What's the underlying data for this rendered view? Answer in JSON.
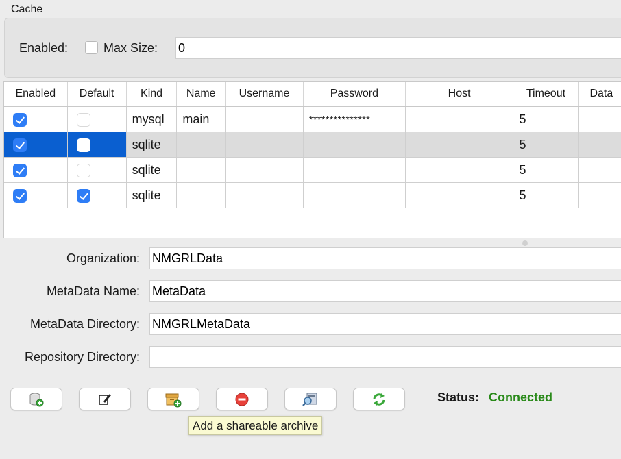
{
  "cache": {
    "group_label": "Cache",
    "enabled_label": "Enabled:",
    "enabled": false,
    "max_size_label": "Max Size:",
    "max_size_value": "0"
  },
  "table": {
    "columns": [
      "Enabled",
      "Default",
      "Kind",
      "Name",
      "Username",
      "Password",
      "Host",
      "Timeout",
      "Data"
    ],
    "rows": [
      {
        "enabled": true,
        "default": false,
        "kind": "mysql",
        "name": "main",
        "username": "",
        "password": "***************",
        "host": "",
        "timeout": "5",
        "data": "",
        "selected": false
      },
      {
        "enabled": true,
        "default": false,
        "kind": "sqlite",
        "name": "",
        "username": "",
        "password": "",
        "host": "",
        "timeout": "5",
        "data": "",
        "selected": true
      },
      {
        "enabled": true,
        "default": false,
        "kind": "sqlite",
        "name": "",
        "username": "",
        "password": "",
        "host": "",
        "timeout": "5",
        "data": "",
        "selected": false
      },
      {
        "enabled": true,
        "default": true,
        "kind": "sqlite",
        "name": "",
        "username": "",
        "password": "",
        "host": "",
        "timeout": "5",
        "data": "",
        "selected": false
      }
    ]
  },
  "form": {
    "organization_label": "Organization:",
    "organization_value": "NMGRLData",
    "metadata_name_label": "MetaData Name:",
    "metadata_name_value": "MetaData",
    "metadata_directory_label": "MetaData Directory:",
    "metadata_directory_value": "NMGRLMetaData",
    "repository_directory_label": "Repository Directory:",
    "repository_directory_value": ""
  },
  "toolbar": {
    "buttons": [
      {
        "icon": "add-database-icon"
      },
      {
        "icon": "edit-icon"
      },
      {
        "icon": "add-archive-icon"
      },
      {
        "icon": "remove-icon"
      },
      {
        "icon": "test-connection-icon"
      },
      {
        "icon": "refresh-icon"
      }
    ],
    "status_label": "Status:",
    "status_value": "Connected",
    "status_color": "#2a8a1a"
  },
  "tooltip": {
    "text": "Add a shareable archive"
  },
  "colors": {
    "accent": "#2e7df6",
    "selection": "#0a5fd0"
  }
}
